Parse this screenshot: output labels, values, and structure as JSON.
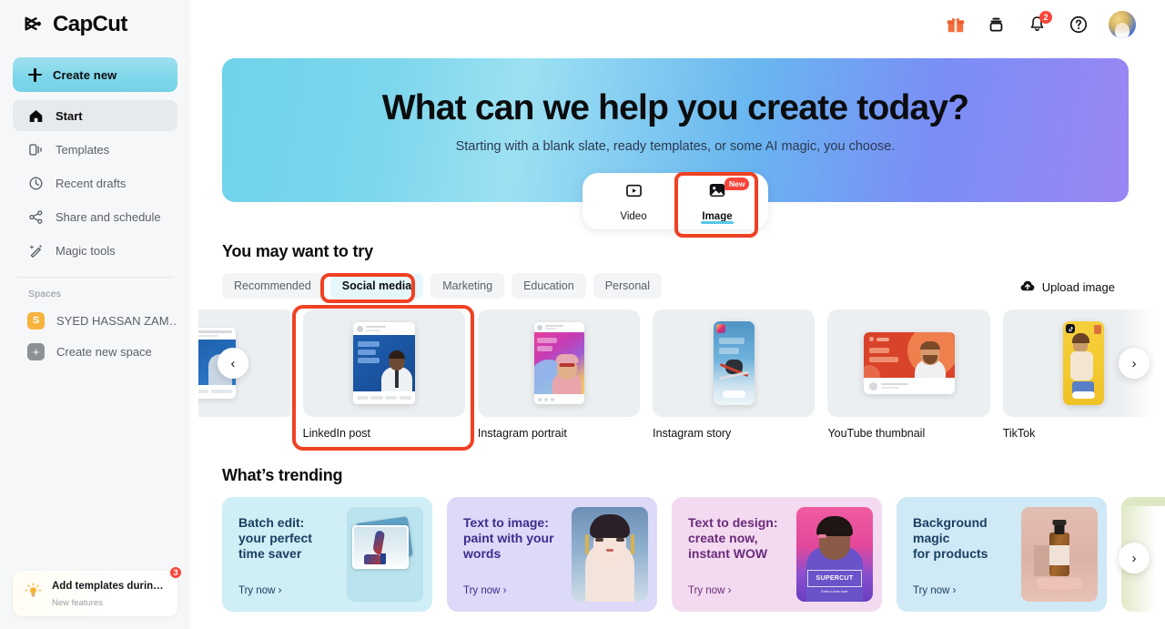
{
  "brand": {
    "name": "CapCut",
    "logo_icon": "capcut-logo-icon"
  },
  "sidebar": {
    "create_new": {
      "label": "Create new",
      "icon": "plus-icon"
    },
    "items": [
      {
        "label": "Start",
        "icon": "home-icon",
        "active": true
      },
      {
        "label": "Templates",
        "icon": "templates-icon",
        "active": false
      },
      {
        "label": "Recent drafts",
        "icon": "clock-icon",
        "active": false
      },
      {
        "label": "Share and schedule",
        "icon": "share-icon",
        "active": false
      },
      {
        "label": "Magic tools",
        "icon": "magic-wand-icon",
        "active": false
      }
    ],
    "spaces_title": "Spaces",
    "spaces": [
      {
        "label": "SYED HASSAN ZAM…",
        "badge": "S",
        "badge_color": "#f6b33e"
      },
      {
        "label": "Create new space",
        "badge": "+",
        "badge_color": "#8c9196"
      }
    ],
    "promo": {
      "title": "Add templates durin…",
      "subtitle": "New features",
      "badge": "3",
      "icon": "lightbulb-icon"
    }
  },
  "topbar": {
    "icons": [
      {
        "name": "gift-icon",
        "badge": ""
      },
      {
        "name": "archive-box-icon",
        "badge": ""
      },
      {
        "name": "bell-icon",
        "badge": "2"
      },
      {
        "name": "help-circle-icon",
        "badge": ""
      }
    ],
    "avatar": {
      "name": "user-avatar"
    }
  },
  "hero": {
    "title": "What can we help you create today?",
    "subtitle": "Starting with a blank slate, ready templates, or some AI magic, you choose.",
    "gradient_from": "#6fd3ea",
    "gradient_to": "#9a86f4",
    "switcher": [
      {
        "label": "Video",
        "icon": "video-play-icon",
        "active": false,
        "badge": ""
      },
      {
        "label": "Image",
        "icon": "image-icon",
        "active": true,
        "badge": "New"
      }
    ]
  },
  "try_section": {
    "title": "You may want to try",
    "tabs": [
      {
        "label": "Recommended",
        "active": false
      },
      {
        "label": "Social media",
        "active": true
      },
      {
        "label": "Marketing",
        "active": false
      },
      {
        "label": "Education",
        "active": false
      },
      {
        "label": "Personal",
        "active": false
      }
    ],
    "upload": {
      "label": "Upload image",
      "icon": "upload-cloud-icon"
    },
    "templates": [
      {
        "label": "",
        "kind": "partial-left"
      },
      {
        "label": "LinkedIn post",
        "kind": "linkedin",
        "highlighted": true
      },
      {
        "label": "Instagram portrait",
        "kind": "instagram-portrait"
      },
      {
        "label": "Instagram story",
        "kind": "instagram-story"
      },
      {
        "label": "YouTube thumbnail",
        "kind": "youtube"
      },
      {
        "label": "TikTok",
        "kind": "tiktok"
      }
    ],
    "prev_arrow": "‹",
    "next_arrow": "›"
  },
  "trending_section": {
    "title": "What’s trending",
    "cards": [
      {
        "title": "Batch edit:\nyour perfect\ntime saver",
        "cta": "Try now ›",
        "bg": "#cfeef5",
        "text_color": "#1b3f63",
        "image": "shoes-photo"
      },
      {
        "title": "Text to image:\npaint with your\nwords",
        "cta": "Try now ›",
        "bg": "#ddd9f8",
        "text_color": "#3b2e8e",
        "image": "ai-portrait-photo"
      },
      {
        "title": "Text to design:\ncreate now,\ninstant WOW",
        "cta": "Try now ›",
        "bg": "#f3daf0",
        "text_color": "#6a2a7a",
        "image": "supercut-poster"
      },
      {
        "title": "Background\nmagic\nfor products",
        "cta": "Try now ›",
        "bg": "#cfe9f6",
        "text_color": "#1b3f63",
        "image": "bottle-product-photo"
      },
      {
        "title": "",
        "cta": "",
        "bg": "#dfe8c4",
        "text_color": "#3d4a20",
        "image": ""
      }
    ],
    "next_arrow": "›"
  },
  "annotations": [
    {
      "name": "image-tab-highlight",
      "color": "#ef4123"
    },
    {
      "name": "social-media-tab-highlight",
      "color": "#ef4123"
    },
    {
      "name": "linkedin-post-card-highlight",
      "color": "#ef4123"
    }
  ]
}
